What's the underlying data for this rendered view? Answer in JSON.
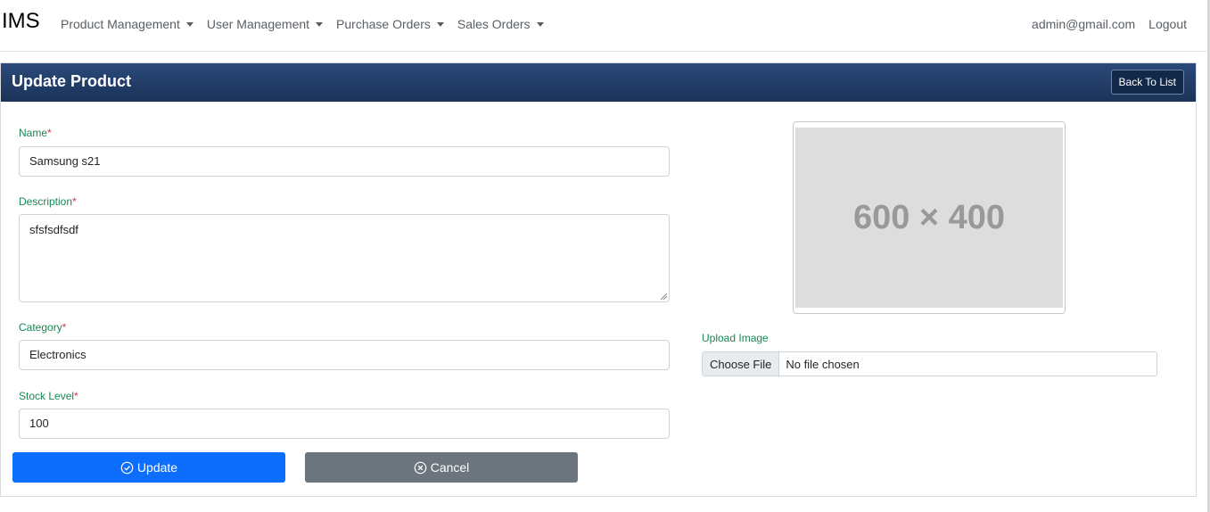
{
  "navbar": {
    "brand": "IMS",
    "menus": [
      "Product Management",
      "User Management",
      "Purchase Orders",
      "Sales Orders"
    ],
    "user_email": "admin@gmail.com",
    "logout": "Logout"
  },
  "card": {
    "title": "Update Product",
    "back_button": "Back To List"
  },
  "form": {
    "name_label": "Name",
    "name_value": "Samsung s21",
    "description_label": "Description",
    "description_value": "sfsfsdfsdf",
    "category_label": "Category",
    "category_value": "Electronics",
    "stock_label": "Stock Level",
    "stock_value": "100",
    "required_marker": "*",
    "update_button": "Update",
    "cancel_button": "Cancel"
  },
  "image": {
    "placeholder_text": "600 × 400",
    "upload_label": "Upload Image",
    "choose_file": "Choose File",
    "no_file": "No file chosen"
  },
  "colors": {
    "header_bg": "#1a3358",
    "label_green": "#198754",
    "required_red": "#dc3545",
    "primary": "#0d6efd",
    "secondary": "#6c757d"
  }
}
